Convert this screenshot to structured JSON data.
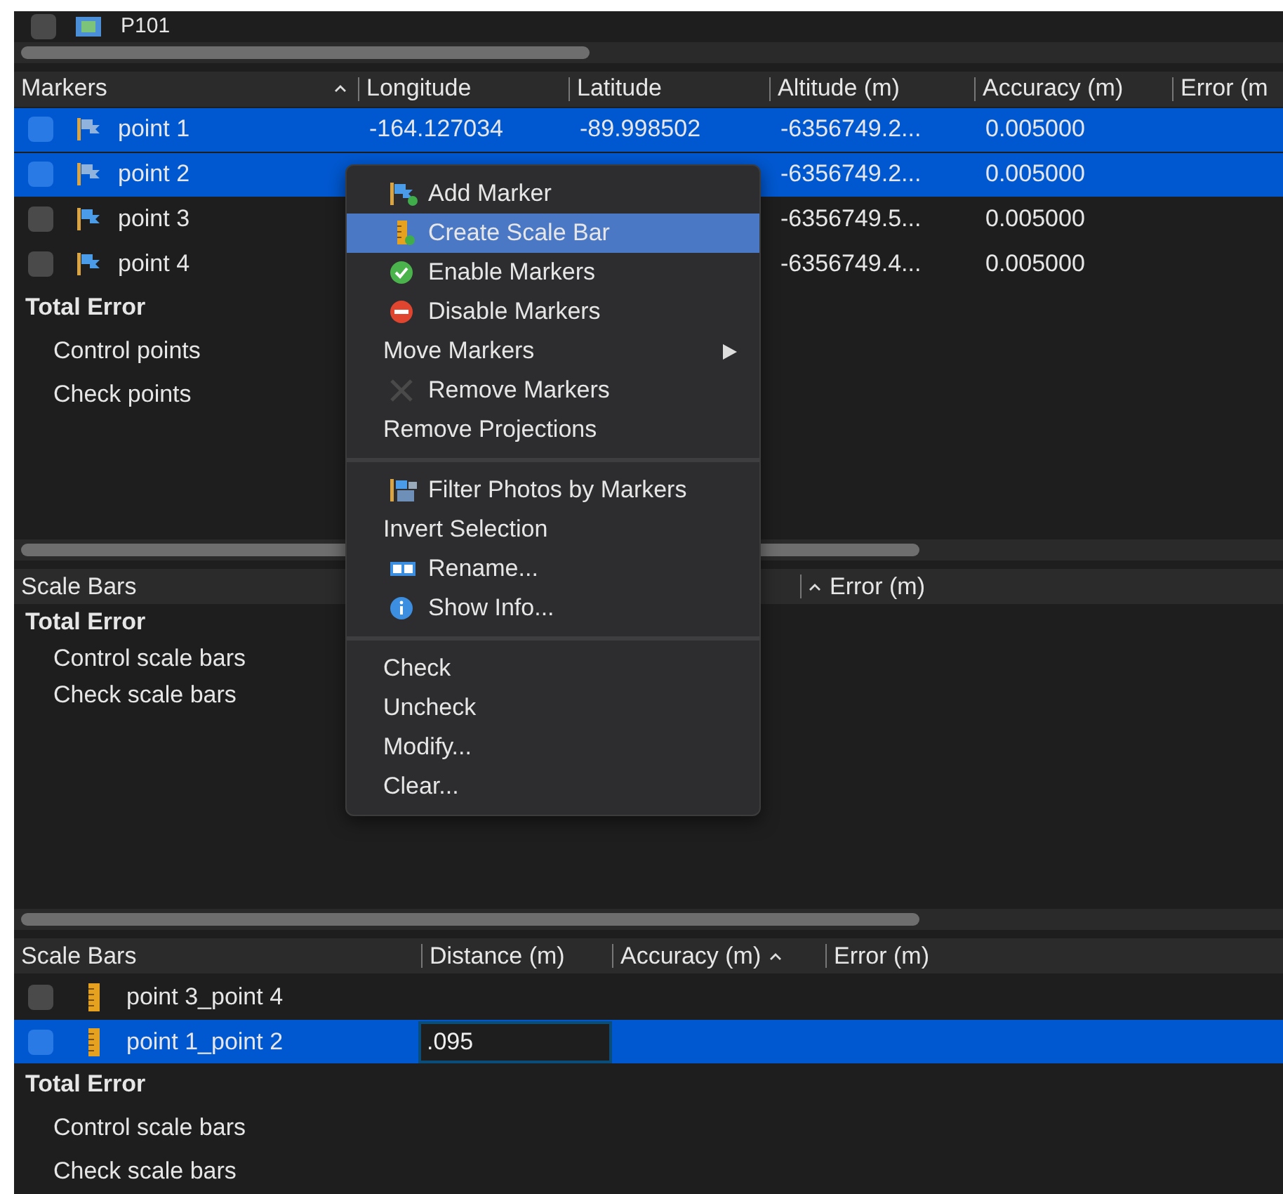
{
  "top_row": {
    "label": "P101",
    "checked": false
  },
  "markers": {
    "columns": [
      {
        "label": "Markers",
        "sorted": true
      },
      {
        "label": "Longitude",
        "sorted": false
      },
      {
        "label": "Latitude",
        "sorted": false
      },
      {
        "label": "Altitude (m)",
        "sorted": false
      },
      {
        "label": "Accuracy (m)",
        "sorted": false
      },
      {
        "label": "Error (m",
        "sorted": false
      }
    ],
    "rows": [
      {
        "selected": true,
        "checked": false,
        "cells": [
          "point 1",
          "-164.127034",
          "-89.998502",
          "-6356749.2...",
          "0.005000"
        ]
      },
      {
        "selected": true,
        "checked": false,
        "cells": [
          "point 2",
          "",
          "",
          "-6356749.2...",
          "0.005000"
        ]
      },
      {
        "selected": false,
        "checked": false,
        "cells": [
          "point 3",
          "",
          "",
          "-6356749.5...",
          "0.005000"
        ]
      },
      {
        "selected": false,
        "checked": false,
        "cells": [
          "point 4",
          "",
          "",
          "-6356749.4...",
          "0.005000"
        ]
      }
    ],
    "summary": [
      {
        "label": "Total Error",
        "kind": "group"
      },
      {
        "label": "Control points",
        "kind": "sub"
      },
      {
        "label": "Check points",
        "kind": "sub"
      }
    ]
  },
  "scale_bars_top": {
    "columns": [
      {
        "label": "Scale Bars",
        "sorted": false
      },
      {
        "label": "Error (m)",
        "sorted": true
      }
    ],
    "summary": [
      {
        "label": "Total Error",
        "kind": "group"
      },
      {
        "label": "Control scale bars",
        "kind": "sub"
      },
      {
        "label": "Check scale bars",
        "kind": "sub"
      }
    ]
  },
  "scale_bars": {
    "columns": [
      {
        "label": "Scale Bars",
        "sorted": false
      },
      {
        "label": "Distance (m)",
        "sorted": false
      },
      {
        "label": "Accuracy (m)",
        "sorted": true
      },
      {
        "label": "Error (m)",
        "sorted": false
      }
    ],
    "rows": [
      {
        "name": "point 3_point 4",
        "selected": false,
        "checked": false
      },
      {
        "name": "point 1_point 2",
        "selected": true,
        "checked": false,
        "editing": true,
        "value": ".095"
      }
    ],
    "summary": [
      {
        "label": "Total Error",
        "kind": "group"
      },
      {
        "label": "Control scale bars",
        "kind": "sub"
      },
      {
        "label": "Check scale bars",
        "kind": "sub"
      }
    ]
  },
  "context_menu": {
    "groups": [
      [
        {
          "label": "Add Marker",
          "kind": "icon",
          "selected": false
        },
        {
          "label": "Create Scale Bar",
          "kind": "icon",
          "selected": true
        },
        {
          "label": "Enable Markers",
          "kind": "icon",
          "selected": false
        },
        {
          "label": "Disable Markers",
          "kind": "icon",
          "selected": false
        },
        {
          "label": "Move Markers",
          "kind": "submenu",
          "selected": false
        },
        {
          "label": "Remove Markers",
          "kind": "icon",
          "selected": false
        },
        {
          "label": "Remove Projections",
          "kind": "plain",
          "selected": false
        }
      ],
      [
        {
          "label": "Filter Photos by Markers",
          "kind": "icon",
          "selected": false
        },
        {
          "label": "Invert Selection",
          "kind": "plain",
          "selected": false
        },
        {
          "label": "Rename...",
          "kind": "icon",
          "selected": false
        },
        {
          "label": "Show Info...",
          "kind": "icon",
          "selected": false
        }
      ],
      [
        {
          "label": "Check",
          "kind": "plain",
          "selected": false
        },
        {
          "label": "Uncheck",
          "kind": "plain",
          "selected": false
        },
        {
          "label": "Modify...",
          "kind": "plain",
          "selected": false
        },
        {
          "label": "Clear...",
          "kind": "plain",
          "selected": false
        }
      ]
    ]
  }
}
